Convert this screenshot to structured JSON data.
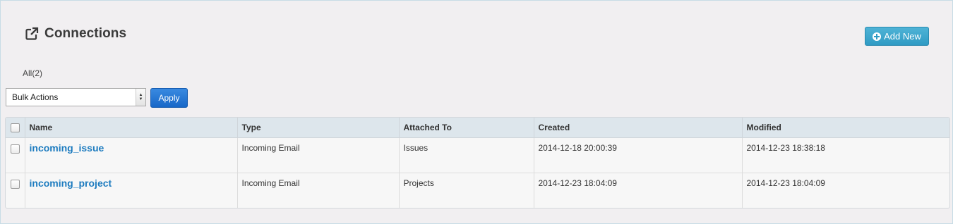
{
  "header": {
    "icon": "external-link-icon",
    "title": "Connections",
    "add_new_label": "Add New"
  },
  "filters": {
    "all_label": "All(2)"
  },
  "bulk": {
    "selected": "Bulk Actions",
    "apply_label": "Apply"
  },
  "table": {
    "columns": [
      "Name",
      "Type",
      "Attached To",
      "Created",
      "Modified"
    ],
    "rows": [
      {
        "name": "incoming_issue",
        "type": "Incoming Email",
        "attached_to": "Issues",
        "created": "2014-12-18 20:00:39",
        "modified": "2014-12-23 18:38:18"
      },
      {
        "name": "incoming_project",
        "type": "Incoming Email",
        "attached_to": "Projects",
        "created": "2014-12-23 18:04:09",
        "modified": "2014-12-23 18:04:09"
      }
    ]
  },
  "colors": {
    "accent": "#2f9bc4",
    "apply": "#1767c8",
    "link": "#1c7bbf"
  }
}
